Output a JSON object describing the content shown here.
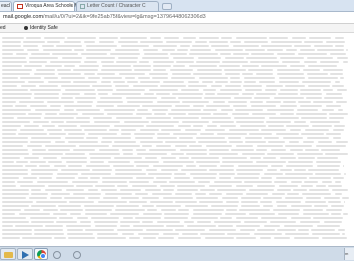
{
  "browser": {
    "tabs": [
      {
        "label": "eacl",
        "active": false
      },
      {
        "label": "Viroqua Area Schools Mail",
        "active": true
      },
      {
        "label": "Letter Count / Character C",
        "active": false
      }
    ],
    "address": {
      "host": "mail.google.com",
      "path": "/mail/u/0/?ui=2&ik=9fe25ab75f&view=lg&msg=13796448062306d3"
    },
    "bookmarks": [
      "ed",
      "Identity Safe"
    ]
  },
  "taskbar": {
    "items": [
      "explorer-icon",
      "media-player-icon",
      "chrome-icon",
      "app-icon",
      "app-icon"
    ],
    "tray_label": "m"
  }
}
